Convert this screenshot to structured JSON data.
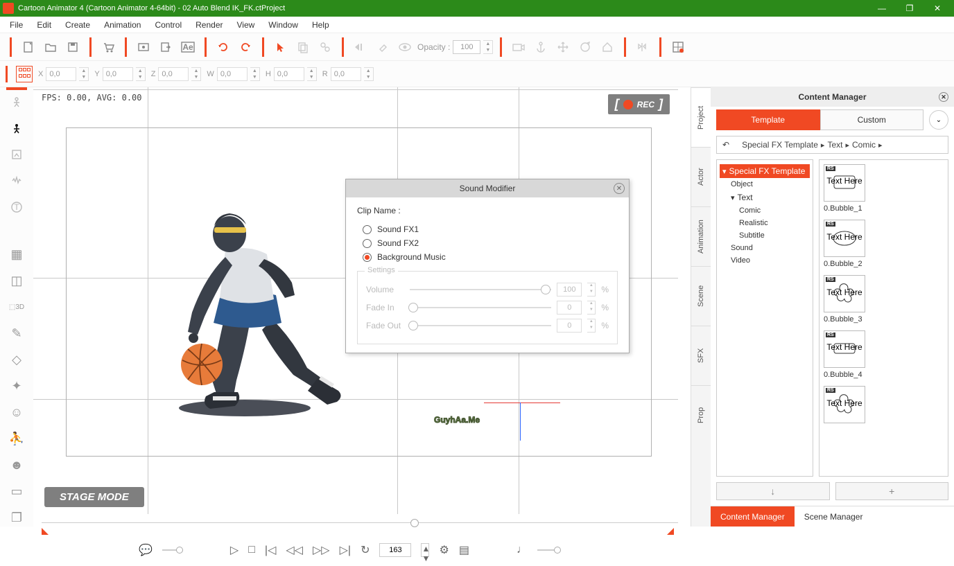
{
  "titlebar": {
    "title": "Cartoon Animator 4  (Cartoon Animator 4-64bit) - 02 Auto Blend IK_FK.ctProject"
  },
  "menu": [
    "File",
    "Edit",
    "Create",
    "Animation",
    "Control",
    "Render",
    "View",
    "Window",
    "Help"
  ],
  "opacity": {
    "label": "Opacity :",
    "value": "100"
  },
  "coords": {
    "X": "0,0",
    "Y": "0,0",
    "Z": "0,0",
    "W": "0,0",
    "H": "0,0",
    "R": "0,0"
  },
  "fps": "FPS: 0.00, AVG: 0.00",
  "rec": "REC",
  "stage": "STAGE MODE",
  "dialog": {
    "title": "Sound Modifier",
    "clipLabel": "Clip Name :",
    "opts": [
      "Sound FX1",
      "Sound FX2",
      "Background Music"
    ],
    "settings": "Settings",
    "rows": [
      {
        "label": "Volume",
        "val": "100",
        "pos": 96
      },
      {
        "label": "Fade In",
        "val": "0",
        "pos": 0
      },
      {
        "label": "Fade Out",
        "val": "0",
        "pos": 0
      }
    ],
    "pct": "%"
  },
  "panel": {
    "title": "Content Manager",
    "tabs": [
      "Template",
      "Custom"
    ],
    "breadcrumb": [
      "Special FX Template",
      "Text",
      "Comic"
    ],
    "sideTabs": [
      "Project",
      "Actor",
      "Animation",
      "Scene",
      "SFX",
      "Prop"
    ],
    "tree": [
      {
        "t": "Special FX Template",
        "sel": true,
        "lvl": 0,
        "exp": true
      },
      {
        "t": "Object",
        "lvl": 1
      },
      {
        "t": "Text",
        "lvl": 1,
        "exp": true
      },
      {
        "t": "Comic",
        "lvl": 2
      },
      {
        "t": "Realistic",
        "lvl": 2
      },
      {
        "t": "Subtitle",
        "lvl": 2
      },
      {
        "t": "Sound",
        "lvl": 1
      },
      {
        "t": "Video",
        "lvl": 1
      }
    ],
    "thumbs": [
      {
        "label": "0.Bubble_1",
        "shape": "rect"
      },
      {
        "label": "0.Bubble_2",
        "shape": "ellipse"
      },
      {
        "label": "0.Bubble_3",
        "shape": "cloud"
      },
      {
        "label": "0.Bubble_4",
        "shape": "rect"
      },
      {
        "label": "",
        "shape": "cloud"
      }
    ],
    "bottomTabs": [
      "Content Manager",
      "Scene Manager"
    ]
  },
  "timeline": {
    "frame": "163"
  }
}
